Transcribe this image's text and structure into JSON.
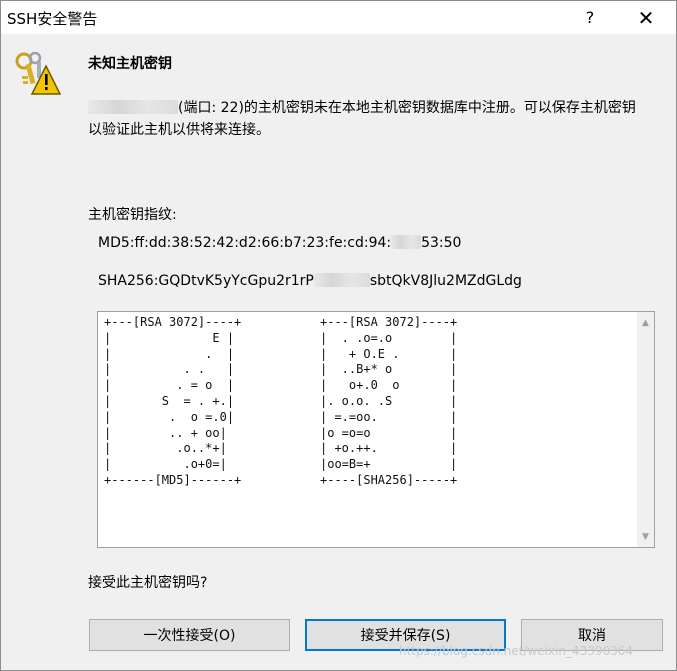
{
  "window": {
    "title": "SSH安全警告",
    "help_glyph": "?",
    "close_glyph": "✕"
  },
  "icon": "key-warning-icon",
  "dialog": {
    "heading": "未知主机密钥",
    "message_line1": "(端口: 22)的主机密钥未在本地主机密钥数据库中注册。可以保存主机密钥",
    "message_line2": "以验证此主机以供将来连接。",
    "fingerprint_label": "主机密钥指纹:",
    "md5_prefix": "MD5:ff:dd:38:52:42:d2:66:b7:23:fe:cd:94:",
    "md5_suffix": "53:50",
    "sha256_prefix": "SHA256:GQDtvK5yYcGpu2r1rP",
    "sha256_suffix": "sbtQkV8Jlu2MZdGLdg",
    "randomart_md5": "+---[RSA 3072]----+\n|              E |\n|             .  |\n|          . .   |\n|         . = o  |\n|       S  = . +.|\n|        .  o =.0|\n|        .. + oo|\n|         .o..*+|\n|          .o+0=|\n+------[MD5]------+",
    "randomart_sha256": "+---[RSA 3072]----+\n|  . .o=.o        |\n|   + O.E .       |\n|  ..B+* o        |\n|   o+.0  o       |\n|. o.o. .S        |\n| =.=oo.          |\n|o =o=o           |\n| +o.++.          |\n|oo=B=+           |\n+----[SHA256]-----+",
    "question": "接受此主机密钥吗?"
  },
  "buttons": {
    "once_label": "一次性接受(O)",
    "save_label": "接受并保存(S)",
    "cancel_label": "取消"
  },
  "watermark": "https://blog.csdn.net/weixin_43390364",
  "colors": {
    "accent": "#0078d7",
    "dialog_bg": "#f0f0f0",
    "button_bg": "#e1e1e1"
  }
}
